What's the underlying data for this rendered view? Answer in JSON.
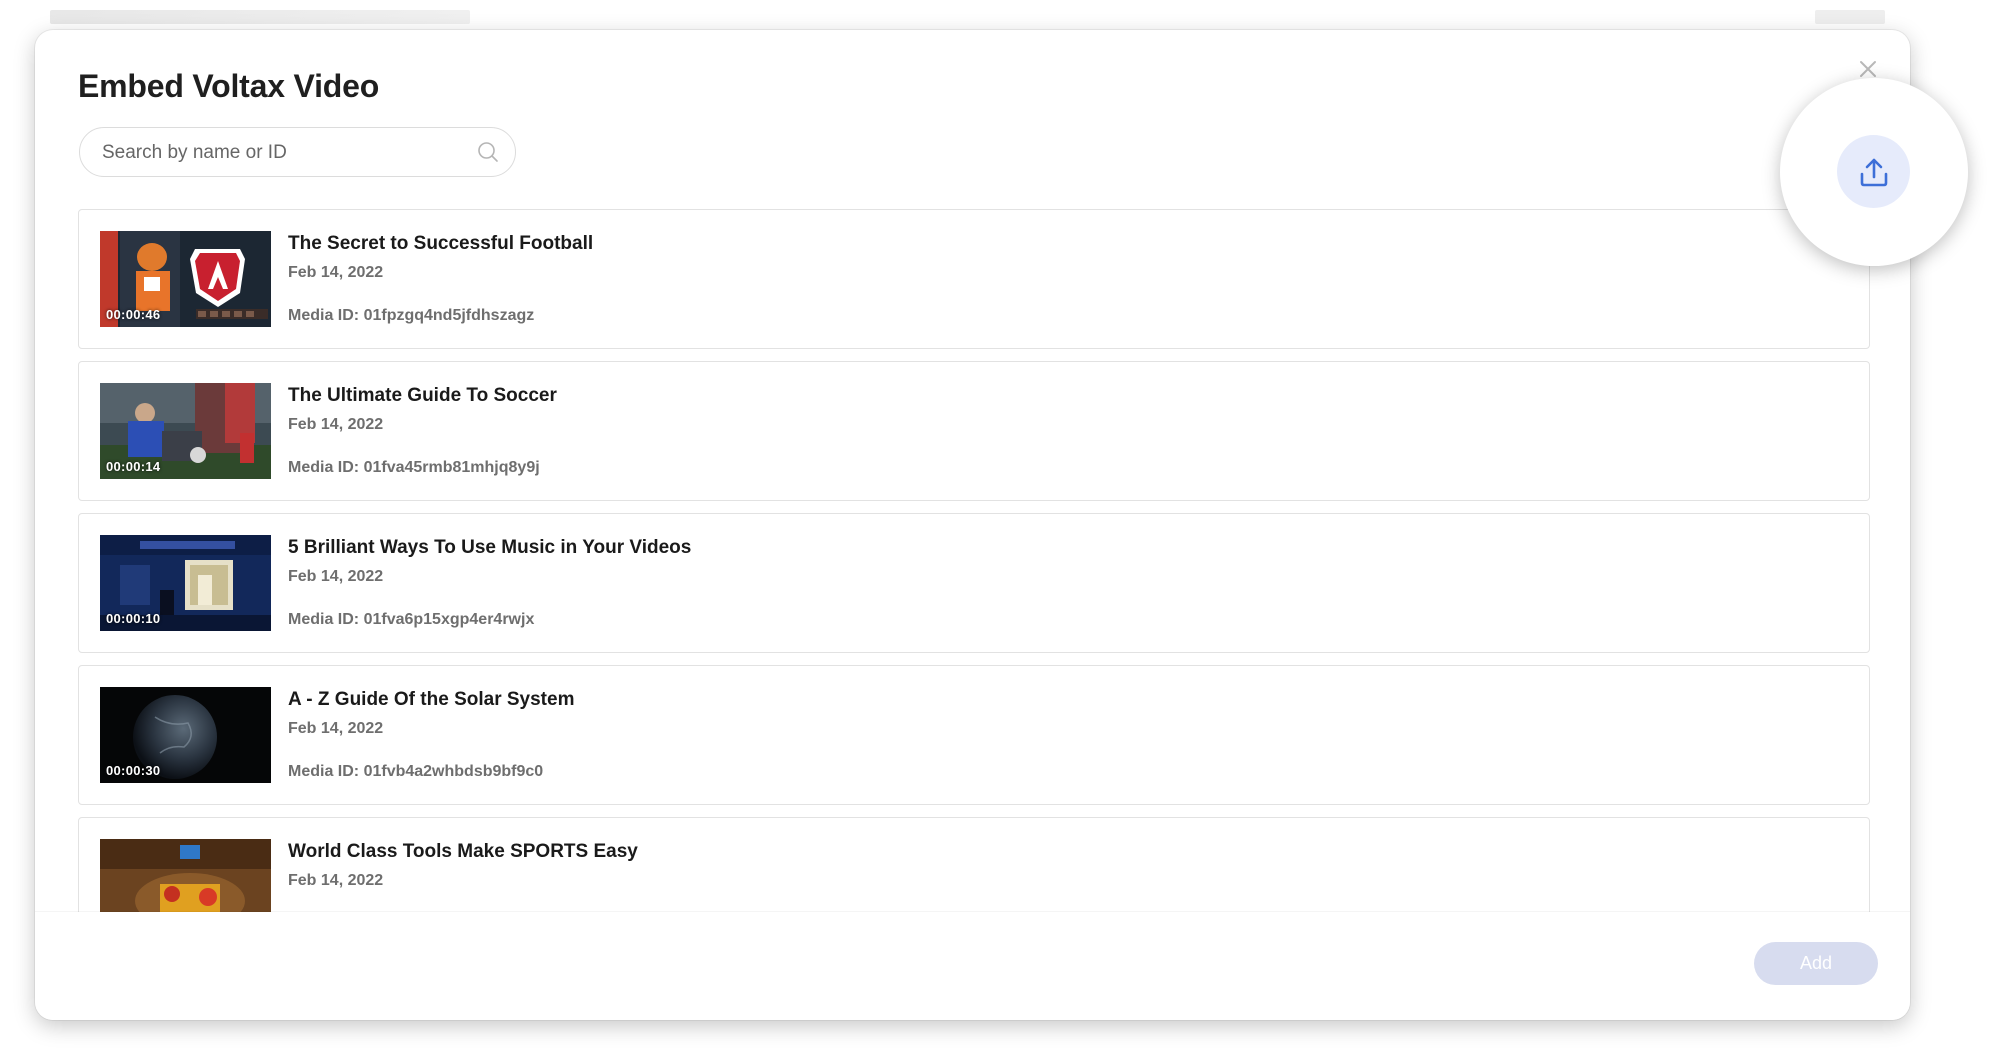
{
  "dialog": {
    "title": "Embed Voltax Video",
    "close_icon": "close-icon"
  },
  "search": {
    "placeholder": "Search by name or ID",
    "value": "",
    "icon": "search-icon"
  },
  "upload": {
    "icon": "upload-icon",
    "accent": "#3d6fd8"
  },
  "videos": [
    {
      "title": "The Secret to Successful Football",
      "date": "Feb 14, 2022",
      "media_id": "Media ID: 01fpzgq4nd5jfdhszagz",
      "duration": "00:00:46"
    },
    {
      "title": "The Ultimate Guide To Soccer",
      "date": "Feb 14, 2022",
      "media_id": "Media ID: 01fva45rmb81mhjq8y9j",
      "duration": "00:00:14"
    },
    {
      "title": "5 Brilliant Ways To Use Music in Your Videos",
      "date": "Feb 14, 2022",
      "media_id": "Media ID: 01fva6p15xgp4er4rwjx",
      "duration": "00:00:10"
    },
    {
      "title": "A - Z Guide Of the Solar System",
      "date": "Feb 14, 2022",
      "media_id": "Media ID: 01fvb4a2whbdsb9bf9c0",
      "duration": "00:00:30"
    },
    {
      "title": "World Class Tools Make SPORTS Easy",
      "date": "Feb 14, 2022"
    }
  ],
  "footer": {
    "add_label": "Add",
    "add_color": "#d7dcef"
  }
}
